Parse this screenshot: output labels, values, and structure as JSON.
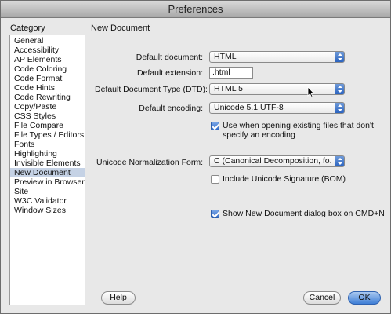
{
  "window": {
    "title": "Preferences"
  },
  "sidebar": {
    "header": "Category",
    "items": [
      "General",
      "Accessibility",
      "AP Elements",
      "Code Coloring",
      "Code Format",
      "Code Hints",
      "Code Rewriting",
      "Copy/Paste",
      "CSS Styles",
      "File Compare",
      "File Types / Editors",
      "Fonts",
      "Highlighting",
      "Invisible Elements",
      "New Document",
      "Preview in Browser",
      "Site",
      "W3C Validator",
      "Window Sizes"
    ],
    "selected": "New Document"
  },
  "panel": {
    "title": "New Document",
    "default_document": {
      "label": "Default document:",
      "value": "HTML"
    },
    "default_extension": {
      "label": "Default extension:",
      "value": ".html"
    },
    "default_dtd": {
      "label": "Default Document Type (DTD):",
      "value": "HTML 5"
    },
    "default_encoding": {
      "label": "Default encoding:",
      "value": "Unicode 5.1 UTF-8"
    },
    "use_when_opening": {
      "line1": "Use when opening existing files that don't",
      "line2": "specify an encoding",
      "checked": true
    },
    "normalization": {
      "label": "Unicode Normalization Form:",
      "value": "C (Canonical Decomposition, fo..."
    },
    "include_bom": {
      "label": "Include Unicode Signature (BOM)",
      "checked": false
    },
    "show_dialog": {
      "label": "Show New Document dialog box on CMD+N",
      "checked": true
    }
  },
  "buttons": {
    "help": "Help",
    "cancel": "Cancel",
    "ok": "OK"
  }
}
